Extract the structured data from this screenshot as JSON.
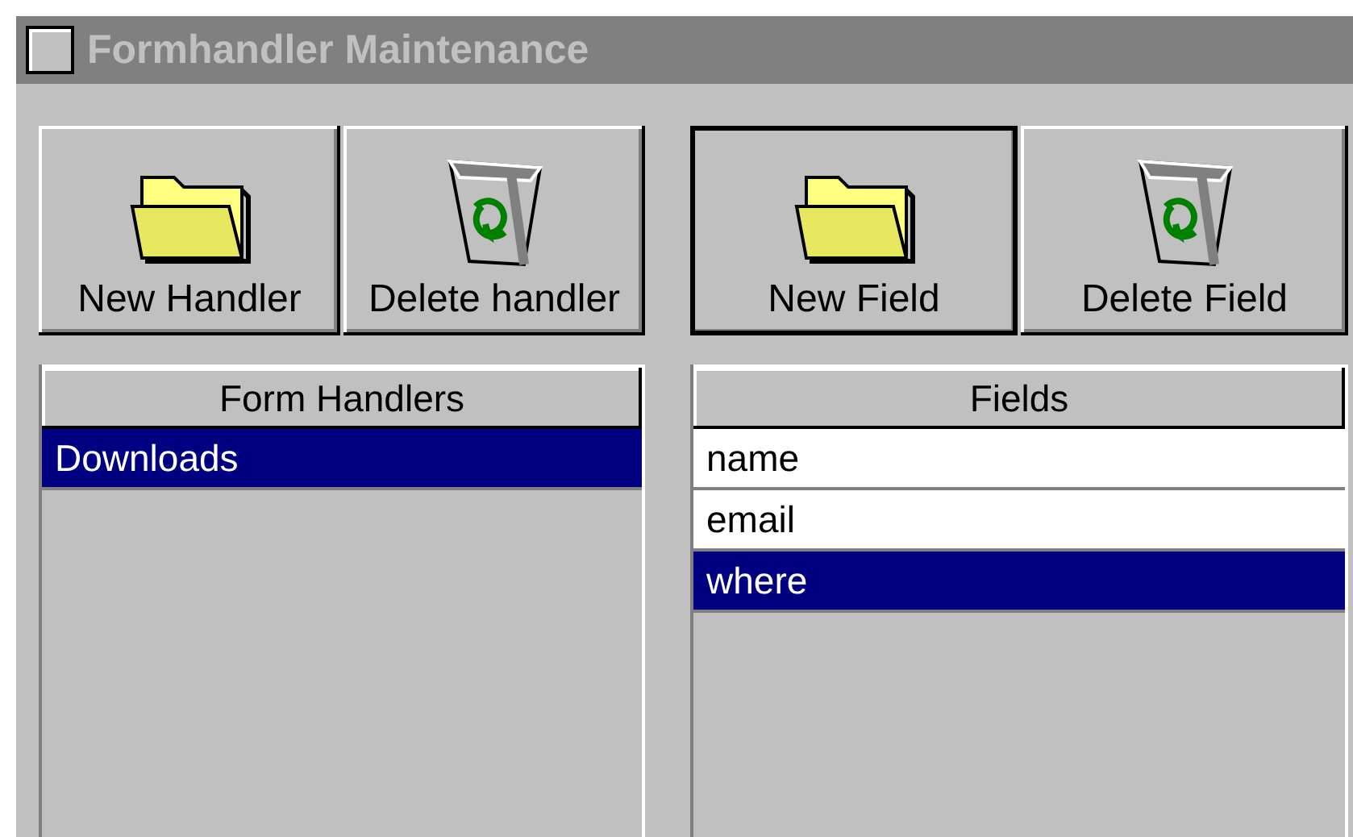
{
  "window": {
    "title": "Formhandler Maintenance",
    "active": false
  },
  "panels": [
    {
      "buttons": [
        {
          "kind": "new",
          "label": "New Handler",
          "default": false
        },
        {
          "kind": "delete",
          "label": "Delete handler",
          "default": false
        }
      ],
      "list": {
        "header": "Form Handlers",
        "items": [
          {
            "label": "Downloads",
            "selected": true
          }
        ]
      }
    },
    {
      "buttons": [
        {
          "kind": "new",
          "label": "New Field",
          "default": true
        },
        {
          "kind": "delete",
          "label": "Delete Field",
          "default": false
        }
      ],
      "list": {
        "header": "Fields",
        "items": [
          {
            "label": "name",
            "selected": false
          },
          {
            "label": "email",
            "selected": false
          },
          {
            "label": "where",
            "selected": true
          }
        ]
      }
    }
  ]
}
